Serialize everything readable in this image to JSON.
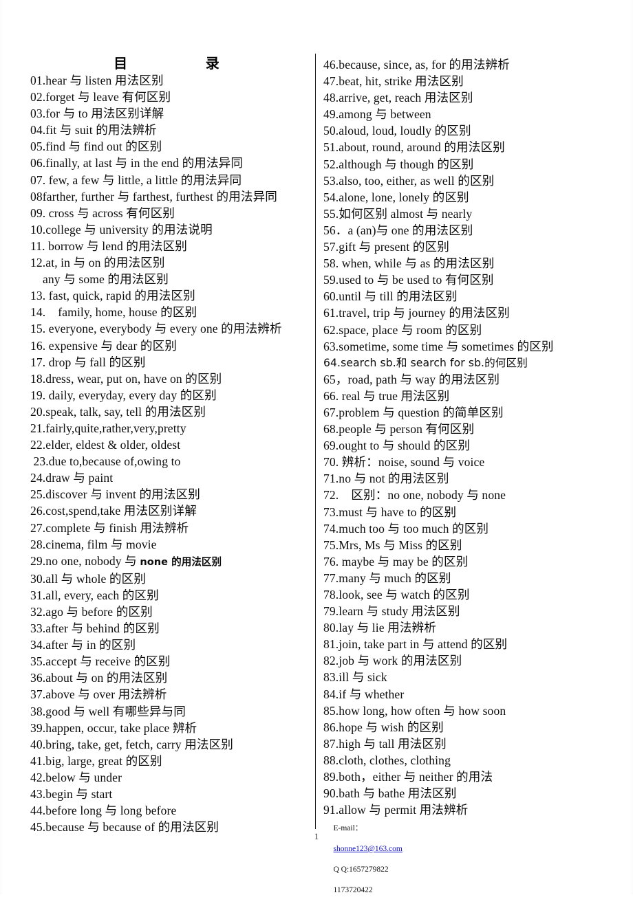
{
  "document": {
    "title": "目          录",
    "page_number": "1"
  },
  "toc": {
    "left_column": [
      {
        "text": "01.hear 与 listen 用法区别"
      },
      {
        "text": "02.forget 与 leave 有何区别"
      },
      {
        "text": "03.for 与 to 用法区别详解"
      },
      {
        "text": "04.fit 与 suit 的用法辨析"
      },
      {
        "text": "05.find 与 find out 的区别"
      },
      {
        "text": "06.finally, at last 与 in the end 的用法异同"
      },
      {
        "text": "07. few, a few 与 little, a little 的用法异同"
      },
      {
        "text": "08farther, further 与 farthest, furthest 的用法异同"
      },
      {
        "text": "09. cross 与 across 有何区别"
      },
      {
        "text": "10.college 与 university 的用法说明"
      },
      {
        "text": "11. borrow 与 lend 的用法区别"
      },
      {
        "text": "12.at, in 与 on 的用法区别"
      },
      {
        "text": "    any 与 some 的用法区别"
      },
      {
        "text": "13. fast, quick, rapid 的用法区别"
      },
      {
        "text": "14.    family, home, house 的区别"
      },
      {
        "text": "15. everyone, everybody 与 every one 的用法辨析"
      },
      {
        "text": "16. expensive 与 dear 的区别"
      },
      {
        "text": "17. drop 与 fall 的区别"
      },
      {
        "text": "18.dress, wear, put on, have on 的区别"
      },
      {
        "text": "19. daily, everyday, every day 的区别"
      },
      {
        "text": "20.speak, talk, say, tell 的用法区别"
      },
      {
        "text": "21.fairly,quite,rather,very,pretty"
      },
      {
        "text": "22.elder, eldest & older, oldest"
      },
      {
        "text": " 23.due to,because of,owing to"
      },
      {
        "text": "24.draw 与 paint"
      },
      {
        "text": "25.discover 与 invent 的用法区别"
      },
      {
        "text": "26.cost,spend,take 用法区别详解"
      },
      {
        "text": "27.complete 与 finish 用法辨析"
      },
      {
        "text": "28.cinema, film 与 movie"
      },
      {
        "text": "29.no one, nobody 与 ",
        "tail": "none 的用法区别",
        "tail_style": "sans"
      },
      {
        "text": "30.all 与 whole 的区别"
      },
      {
        "text": "31.all, every, each 的区别"
      },
      {
        "text": "32.ago 与 before 的区别"
      },
      {
        "text": "33.after 与 behind 的区别"
      },
      {
        "text": "34.after 与 in 的区别"
      },
      {
        "text": "35.accept 与 receive 的区别"
      },
      {
        "text": "36.about 与 on 的用法区别"
      },
      {
        "text": "37.above 与 over 用法辨析"
      },
      {
        "text": "38.good 与 well 有哪些异与同"
      },
      {
        "text": "39.happen, occur, take place 辨析"
      },
      {
        "text": "40.bring, take, get, fetch, carry 用法区别"
      },
      {
        "text": "41.big, large, great 的区别"
      },
      {
        "text": "42.below 与 under"
      },
      {
        "text": "43.begin 与 start"
      },
      {
        "text": "44.before long 与 long before"
      },
      {
        "text": "45.because 与 because of 的用法区别"
      }
    ],
    "right_column": [
      {
        "text": "46.because, since, as, for 的用法辨析"
      },
      {
        "text": "47.beat, hit, strike 用法区别"
      },
      {
        "text": "48.arrive, get, reach 用法区别"
      },
      {
        "text": "49.among 与 between"
      },
      {
        "text": "50.aloud, loud, loudly 的区别"
      },
      {
        "text": "51.about, round, around 的用法区别"
      },
      {
        "text": "52.although 与 though 的区别"
      },
      {
        "text": "53.also, too, either, as well 的区别"
      },
      {
        "text": "54.alone, lone, lonely 的区别"
      },
      {
        "text": "55.如何区别 almost 与 nearly"
      },
      {
        "text": "56．a (an)与 one 的用法区别"
      },
      {
        "text": "57.gift 与 present 的区别"
      },
      {
        "text": "58. when, while 与 as 的用法区别"
      },
      {
        "text": "59.used to 与 be used to 有何区别"
      },
      {
        "text": "60.until 与 till 的用法区别"
      },
      {
        "text": "61.travel, trip 与 journey 的用法区别"
      },
      {
        "text": "62.space, place 与 room 的区别"
      },
      {
        "text": "63.sometime, some time 与 sometimes 的区别"
      },
      {
        "text": "64.search sb.和 search for sb.的何区别",
        "style": "sans"
      },
      {
        "text": "65，road, path 与 way 的用法区别"
      },
      {
        "text": "66. real 与 true 用法区别"
      },
      {
        "text": "67.problem 与 question 的简单区别"
      },
      {
        "text": "68.people 与 person 有何区别"
      },
      {
        "text": "69.ought to 与 should 的区别"
      },
      {
        "text": "70. 辨析：noise, sound 与 voice"
      },
      {
        "text": "71.no 与 not 的用法区别"
      },
      {
        "text": "72.    区别：no one, nobody 与 none"
      },
      {
        "text": "73.must 与 have to 的区别"
      },
      {
        "text": "74.much too 与 too much 的区别"
      },
      {
        "text": "75.Mrs, Ms 与 Miss 的区别"
      },
      {
        "text": "76. maybe 与 may be 的区别"
      },
      {
        "text": "77.many 与 much 的区别"
      },
      {
        "text": "78.look, see 与 watch 的区别"
      },
      {
        "text": "79.learn 与 study 用法区别"
      },
      {
        "text": "80.lay 与 lie 用法辨析"
      },
      {
        "text": "81.join, take part in 与 attend 的区别"
      },
      {
        "text": "82.job 与 work 的用法区别"
      },
      {
        "text": "83.ill 与 sick"
      },
      {
        "text": "84.if 与 whether"
      },
      {
        "text": "85.how long, how often 与 how soon"
      },
      {
        "text": "86.hope 与 wish 的区别"
      },
      {
        "text": "87.high 与 tall 用法区别"
      },
      {
        "text": "88.cloth, clothes, clothing"
      },
      {
        "text": "89.both，either 与 neither 的用法"
      },
      {
        "text": "90.bath 与 bathe 用法区别"
      },
      {
        "text": "91.allow 与 permit 用法辨析"
      }
    ]
  },
  "footer": {
    "email_label": "E-mail：",
    "email_address": "shonne123@163.com",
    "qq_label": "Q Q:1657279822",
    "qq_second": "1173720422"
  },
  "colors": {
    "text": "#0d0d0d",
    "link": "#1414c8",
    "rule": "#1a1a1a"
  }
}
